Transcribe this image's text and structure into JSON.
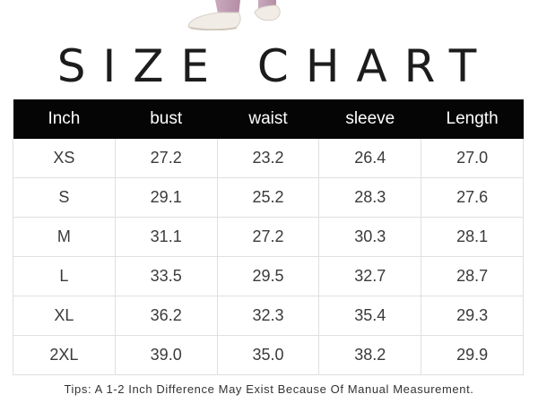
{
  "title": "SIZE CHART",
  "table": {
    "headers": [
      "Inch",
      "bust",
      "waist",
      "sleeve",
      "Length"
    ],
    "rows": [
      [
        "XS",
        "27.2",
        "23.2",
        "26.4",
        "27.0"
      ],
      [
        "S",
        "29.1",
        "25.2",
        "28.3",
        "27.6"
      ],
      [
        "M",
        "31.1",
        "27.2",
        "30.3",
        "28.1"
      ],
      [
        "L",
        "33.5",
        "29.5",
        "32.7",
        "28.7"
      ],
      [
        "XL",
        "36.2",
        "32.3",
        "35.4",
        "29.3"
      ],
      [
        "2XL",
        "39.0",
        "35.0",
        "38.2",
        "29.9"
      ]
    ]
  },
  "tips": "Tips: A 1-2 Inch Difference May Exist Because Of Manual Measurement.",
  "colors": {
    "header_background": "#050505",
    "header_text": "#ffffff",
    "cell_border": "#e0e0e0"
  }
}
